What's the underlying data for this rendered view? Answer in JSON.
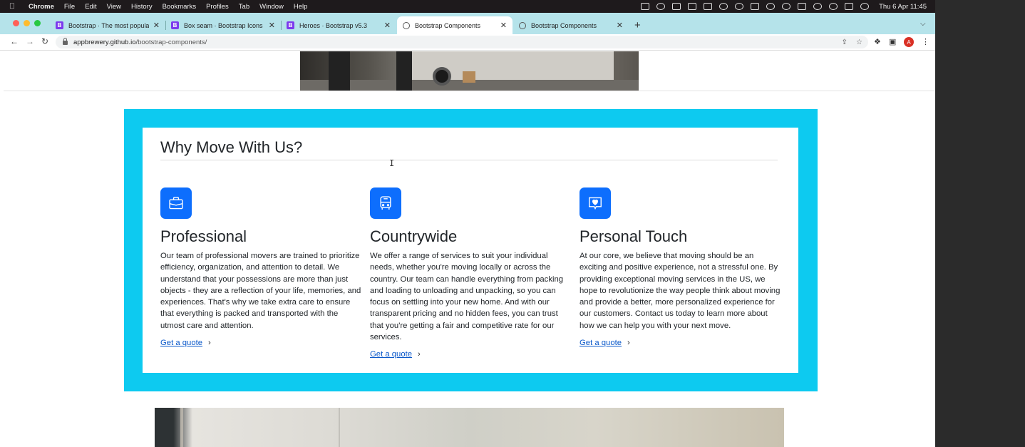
{
  "menubar": {
    "app": "Chrome",
    "items": [
      "File",
      "Edit",
      "View",
      "History",
      "Bookmarks",
      "Profiles",
      "Tab",
      "Window",
      "Help"
    ],
    "clock": "Thu 6 Apr  11:45"
  },
  "tabs": [
    {
      "title": "Bootstrap · The most popular HTML",
      "favicon": "B"
    },
    {
      "title": "Box seam · Bootstrap Icons",
      "favicon": "B"
    },
    {
      "title": "Heroes · Bootstrap v5.3",
      "favicon": "B"
    },
    {
      "title": "Bootstrap Components",
      "favicon": "globe-icon"
    },
    {
      "title": "Bootstrap Components",
      "favicon": "globe-icon"
    }
  ],
  "address": {
    "host": "appbrewery.github.io",
    "path": "/bootstrap-components/"
  },
  "profile_initial": "A",
  "section": {
    "heading": "Why Move With Us?",
    "features": [
      {
        "icon": "briefcase-icon",
        "title": "Professional",
        "text": "Our team of professional movers are trained to prioritize efficiency, organization, and attention to detail. We understand that your possessions are more than just objects - they are a reflection of your life, memories, and experiences. That's why we take extra care to ensure that everything is packed and transported with the utmost care and attention.",
        "link": "Get a quote"
      },
      {
        "icon": "bus-icon",
        "title": "Countrywide",
        "text": "We offer a range of services to suit your individual needs, whether you're moving locally or across the country. Our team can handle everything from packing and loading to unloading and unpacking, so you can focus on settling into your new home. And with our transparent pricing and no hidden fees, you can trust that you're getting a fair and competitive rate for our services.",
        "link": "Get a quote"
      },
      {
        "icon": "chat-heart-icon",
        "title": "Personal Touch",
        "text": "At our core, we believe that moving should be an exciting and positive experience, not a stressful one. By providing exceptional moving services in the US, we hope to revolutionize the way people think about moving and provide a better, more personalized experience for our customers. Contact us today to learn more about how we can help you with your next move.",
        "link": "Get a quote"
      }
    ]
  },
  "colors": {
    "cyan": "#0dcaf0",
    "primary": "#0d6efd",
    "tabstrip": "#b5e3ea"
  }
}
